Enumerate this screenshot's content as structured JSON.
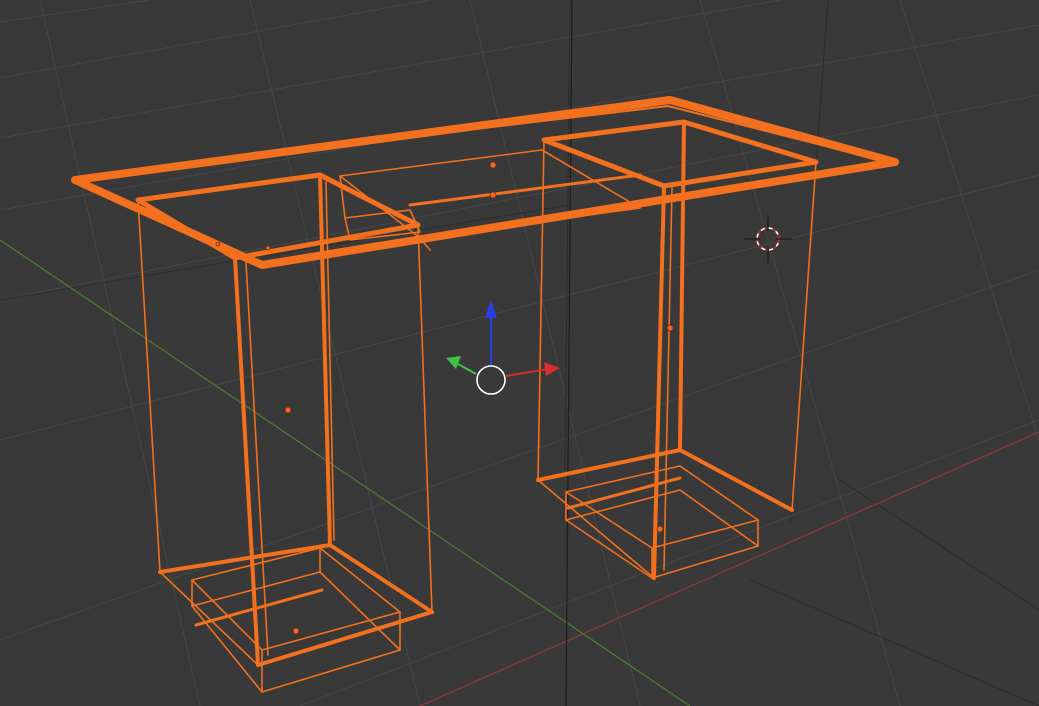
{
  "viewport": {
    "view": "3D Viewport",
    "shading": "wireframe",
    "background_color": "#393939",
    "grid_color": "#474747",
    "x_axis_color": "#8a3a3a",
    "y_axis_color": "#4d7a33",
    "z_axis_color": "#1a1a1a"
  },
  "selection": {
    "object": "desk",
    "selected": true,
    "outline_color": "#f2701e",
    "origin_dot_color": "#e8692a"
  },
  "gizmo": {
    "icon": "transform-manipulator-icon",
    "x_color": "#d62d2d",
    "y_color": "#3ec43e",
    "z_color": "#2a40e6",
    "center_ring_color": "#ffffff"
  },
  "cursor": {
    "icon": "3d-cursor-icon",
    "ring_colors": [
      "#c82828",
      "#ffffff"
    ]
  }
}
